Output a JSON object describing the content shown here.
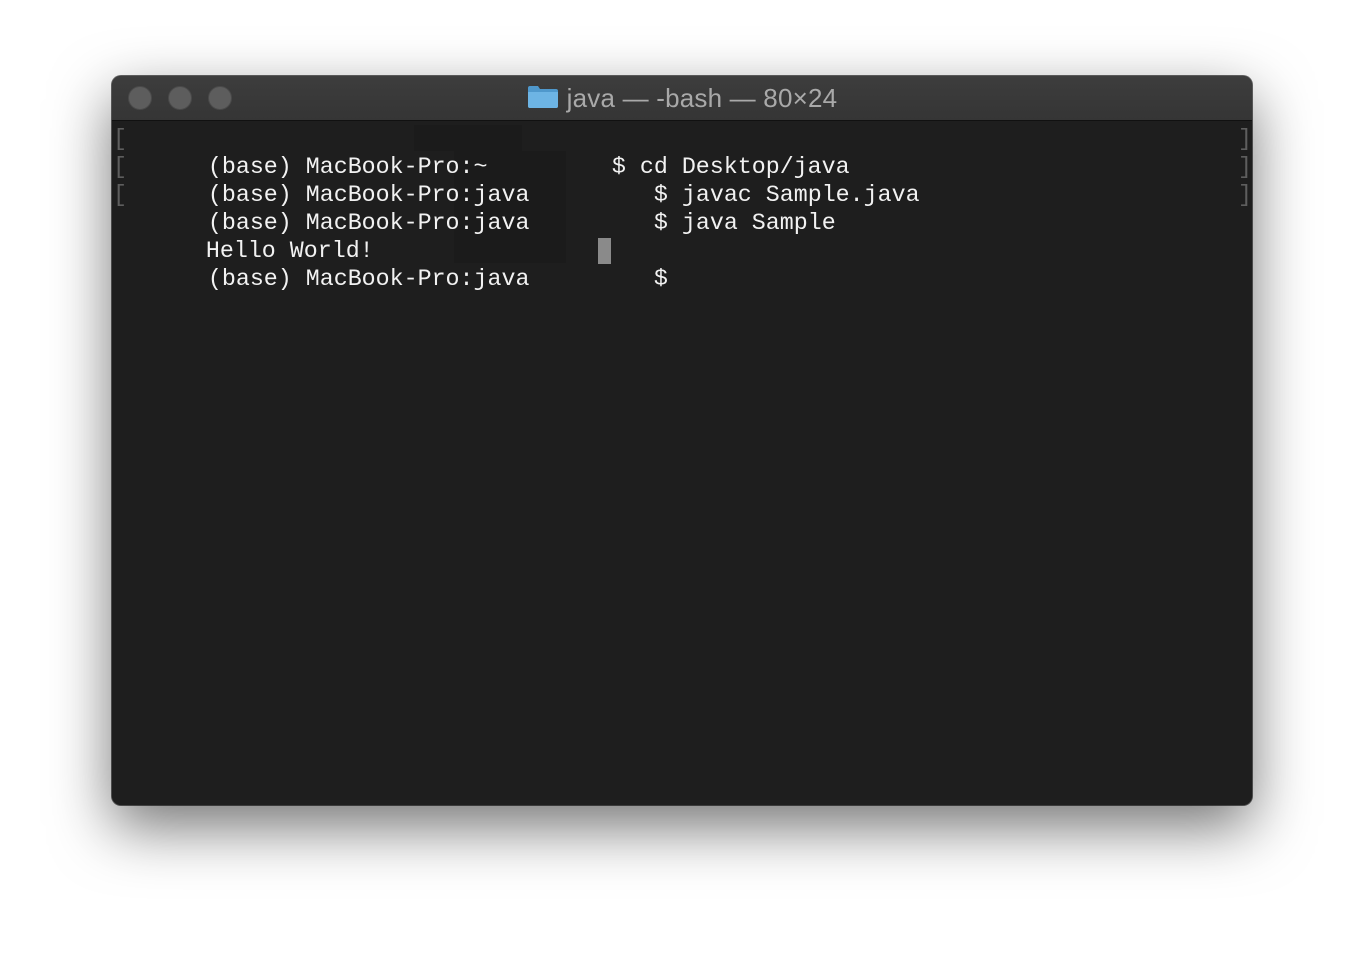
{
  "window": {
    "title": "java — -bash — 80×24",
    "folder_icon": "folder-icon",
    "folder_color": "#5fa8d8",
    "traffic_lights": [
      "close-button",
      "minimize-button",
      "zoom-button"
    ]
  },
  "terminal": {
    "lines": [
      {
        "prompt": "(base) MacBook-Pro:~",
        "dollar": "$",
        "command": "cd Desktop/java"
      },
      {
        "prompt": "(base) MacBook-Pro:java",
        "dollar": "$",
        "command": "javac Sample.java"
      },
      {
        "prompt": "(base) MacBook-Pro:java",
        "dollar": "$",
        "command": "java Sample"
      },
      {
        "output": "Hello World!"
      },
      {
        "prompt": "(base) MacBook-Pro:java",
        "dollar": "$",
        "command": ""
      }
    ],
    "bracket_open": "[",
    "bracket_close": "]",
    "background": "#1e1e1e",
    "text_color": "#f2f2f2"
  }
}
